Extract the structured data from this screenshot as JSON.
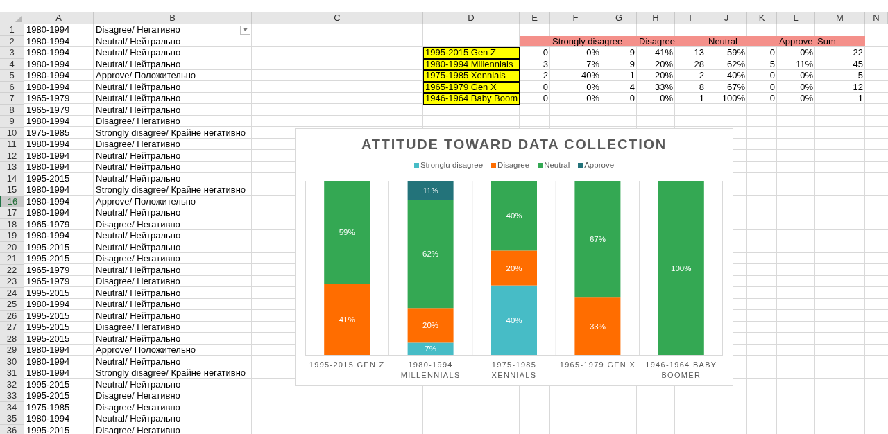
{
  "sheet": {
    "columns": [
      "A",
      "B",
      "C",
      "D",
      "E",
      "F",
      "G",
      "H",
      "I",
      "J",
      "K",
      "L",
      "M",
      "N"
    ],
    "rows": [
      {
        "number": "1",
        "a": "1980-1994",
        "b": "Disagree/ Негативно",
        "selected": false,
        "filter": true
      },
      {
        "number": "2",
        "a": "1980-1994",
        "b": "Neutral/ Нейтрально",
        "selected": false
      },
      {
        "number": "3",
        "a": "1980-1994",
        "b": "Neutral/ Нейтрально",
        "selected": false
      },
      {
        "number": "4",
        "a": "1980-1994",
        "b": "Neutral/ Нейтрально",
        "selected": false
      },
      {
        "number": "5",
        "a": "1980-1994",
        "b": "Approve/ Положительно",
        "selected": false
      },
      {
        "number": "6",
        "a": "1980-1994",
        "b": "Neutral/ Нейтрально",
        "selected": false
      },
      {
        "number": "7",
        "a": "1965-1979",
        "b": "Neutral/ Нейтрально",
        "selected": false
      },
      {
        "number": "8",
        "a": "1965-1979",
        "b": "Neutral/ Нейтрально",
        "selected": false
      },
      {
        "number": "9",
        "a": "1980-1994",
        "b": "Disagree/ Негативно",
        "selected": false
      },
      {
        "number": "10",
        "a": "1975-1985",
        "b": "Strongly disagree/ Крайне негативно",
        "selected": false
      },
      {
        "number": "11",
        "a": "1980-1994",
        "b": "Disagree/ Негативно",
        "selected": false
      },
      {
        "number": "12",
        "a": "1980-1994",
        "b": "Neutral/ Нейтрально",
        "selected": false
      },
      {
        "number": "13",
        "a": "1980-1994",
        "b": "Neutral/ Нейтрально",
        "selected": false
      },
      {
        "number": "14",
        "a": "1995-2015",
        "b": "Neutral/ Нейтрально",
        "selected": false
      },
      {
        "number": "15",
        "a": "1980-1994",
        "b": "Strongly disagree/ Крайне негативно",
        "selected": false
      },
      {
        "number": "16",
        "a": "1980-1994",
        "b": "Approve/ Положительно",
        "selected": true
      },
      {
        "number": "17",
        "a": "1980-1994",
        "b": "Neutral/ Нейтрально",
        "selected": false
      },
      {
        "number": "18",
        "a": "1965-1979",
        "b": "Disagree/ Негативно",
        "selected": false
      },
      {
        "number": "19",
        "a": "1980-1994",
        "b": "Neutral/ Нейтрально",
        "selected": false
      },
      {
        "number": "20",
        "a": "1995-2015",
        "b": "Neutral/ Нейтрально",
        "selected": false
      },
      {
        "number": "21",
        "a": "1995-2015",
        "b": "Disagree/ Негативно",
        "selected": false
      },
      {
        "number": "22",
        "a": "1965-1979",
        "b": "Neutral/ Нейтрально",
        "selected": false
      },
      {
        "number": "23",
        "a": "1965-1979",
        "b": "Disagree/ Негативно",
        "selected": false
      },
      {
        "number": "24",
        "a": "1995-2015",
        "b": "Neutral/ Нейтрально",
        "selected": false
      },
      {
        "number": "25",
        "a": "1980-1994",
        "b": "Neutral/ Нейтрально",
        "selected": false
      },
      {
        "number": "26",
        "a": "1995-2015",
        "b": "Neutral/ Нейтрально",
        "selected": false
      },
      {
        "number": "27",
        "a": "1995-2015",
        "b": "Disagree/ Негативно",
        "selected": false
      },
      {
        "number": "28",
        "a": "1995-2015",
        "b": "Neutral/ Нейтрально",
        "selected": false
      },
      {
        "number": "29",
        "a": "1980-1994",
        "b": "Approve/ Положительно",
        "selected": false
      },
      {
        "number": "30",
        "a": "1980-1994",
        "b": "Neutral/ Нейтрально",
        "selected": false
      },
      {
        "number": "31",
        "a": "1980-1994",
        "b": "Strongly disagree/ Крайне негативно",
        "selected": false
      },
      {
        "number": "32",
        "a": "1995-2015",
        "b": "Neutral/ Нейтрально",
        "selected": false
      },
      {
        "number": "33",
        "a": "1995-2015",
        "b": "Disagree/ Негативно",
        "selected": false
      },
      {
        "number": "34",
        "a": "1975-1985",
        "b": "Disagree/ Негативно",
        "selected": false
      },
      {
        "number": "35",
        "a": "1980-1994",
        "b": "Neutral/ Нейтрально",
        "selected": false
      },
      {
        "number": "36",
        "a": "1995-2015",
        "b": "Disagree/ Негативно",
        "selected": false
      }
    ],
    "summary": {
      "header": [
        "Strongly disagree",
        "Disagree",
        "Neutral",
        "Approve",
        "Sum"
      ],
      "rows": [
        {
          "group": "1995-2015 Gen Z",
          "cells": [
            "0",
            "0%",
            "9",
            "41%",
            "13",
            "59%",
            "0",
            "0%",
            "22"
          ]
        },
        {
          "group": "1980-1994 Millennials",
          "cells": [
            "3",
            "7%",
            "9",
            "20%",
            "28",
            "62%",
            "5",
            "11%",
            "45"
          ]
        },
        {
          "group": "1975-1985 Xennials",
          "cells": [
            "2",
            "40%",
            "1",
            "20%",
            "2",
            "40%",
            "0",
            "0%",
            "5"
          ]
        },
        {
          "group": "1965-1979 Gen X",
          "cells": [
            "0",
            "0%",
            "4",
            "33%",
            "8",
            "67%",
            "0",
            "0%",
            "12"
          ]
        },
        {
          "group": "1946-1964 Baby Boom",
          "cells": [
            "0",
            "0%",
            "0",
            "0%",
            "1",
            "100%",
            "0",
            "0%",
            "1"
          ]
        }
      ]
    }
  },
  "chart": {
    "chart_data": {
      "type": "bar",
      "title": "ATTITUDE TOWARD DATA COLLECTION",
      "stacked": true,
      "legend": "top",
      "categories": [
        "1995-2015 GEN Z",
        "1980-1994 MILLENNIALS",
        "1975-1985 XENNIALS",
        "1965-1979 GEN X",
        "1946-1964 BABY BOOMER"
      ],
      "series": [
        {
          "name": "Stronglu disagree",
          "color": "#47bcc6",
          "values": [
            0,
            7,
            40,
            0,
            0
          ],
          "value_labels": [
            null,
            "7%",
            "40%",
            null,
            null
          ]
        },
        {
          "name": "Disagree",
          "color": "#ff6d00",
          "values": [
            41,
            20,
            20,
            33,
            0
          ],
          "value_labels": [
            "41%",
            "20%",
            "20%",
            "33%",
            null
          ]
        },
        {
          "name": "Neutral",
          "color": "#34a853",
          "values": [
            59,
            62,
            40,
            67,
            100
          ],
          "value_labels": [
            "59%",
            "62%",
            "40%",
            "67%",
            "100%"
          ]
        },
        {
          "name": "Approve",
          "color": "#23737a",
          "values": [
            0,
            11,
            0,
            0,
            0
          ],
          "value_labels": [
            null,
            "11%",
            null,
            null,
            null
          ]
        }
      ]
    }
  }
}
